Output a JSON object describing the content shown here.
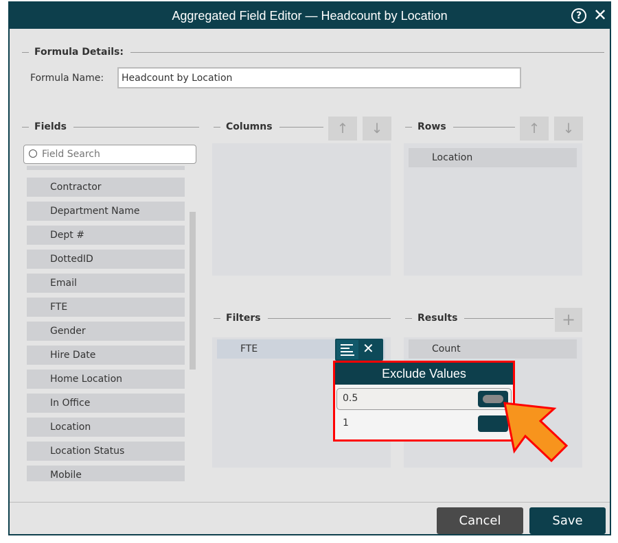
{
  "dialog": {
    "title": "Aggregated Field Editor — Headcount by Location",
    "help_icon": "help-circle-icon",
    "close_icon": "close-icon"
  },
  "formula": {
    "section": "Formula Details:",
    "name_label": "Formula Name:",
    "name_value": "Headcount by Location"
  },
  "fields": {
    "section": "Fields",
    "search_placeholder": "Field Search",
    "items": [
      "Contractor",
      "Department Name",
      "Dept #",
      "DottedID",
      "Email",
      "FTE",
      "Gender",
      "Hire Date",
      "Home Location",
      "In Office",
      "Location",
      "Location Status",
      "Mobile"
    ]
  },
  "columns": {
    "section": "Columns",
    "items": []
  },
  "rows": {
    "section": "Rows",
    "items": [
      "Location"
    ]
  },
  "filters": {
    "section": "Filters",
    "items": [
      "FTE"
    ]
  },
  "results": {
    "section": "Results",
    "items": [
      "Count"
    ]
  },
  "exclude_popup": {
    "title": "Exclude Values",
    "values": [
      {
        "label": "0.5",
        "toggled": true
      },
      {
        "label": "1",
        "toggled": false
      }
    ]
  },
  "footer": {
    "cancel": "Cancel",
    "save": "Save"
  },
  "colors": {
    "primary": "#0d3f4c",
    "highlight": "#ff0000",
    "pointer": "#f7941d"
  }
}
